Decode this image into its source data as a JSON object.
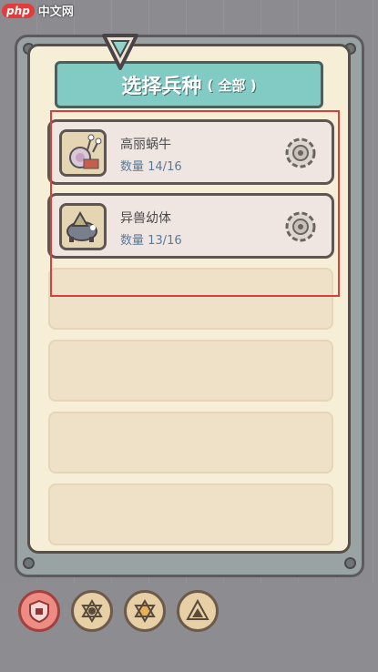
{
  "watermark": {
    "logo": "php",
    "text": "中文网"
  },
  "title": {
    "main": "选择兵种",
    "sub": "( 全部 )"
  },
  "units": [
    {
      "name": "高丽蜗牛",
      "count_label": "数量",
      "count": "14/16"
    },
    {
      "name": "异兽幼体",
      "count_label": "数量",
      "count": "13/16"
    }
  ],
  "empty_slots": 4,
  "bottom_buttons": [
    {
      "id": "defense",
      "icon": "shield-icon",
      "active": true
    },
    {
      "id": "hexagram-circle",
      "icon": "hexagram-icon",
      "active": false
    },
    {
      "id": "hexagram-star",
      "icon": "star-icon",
      "active": false
    },
    {
      "id": "triangle-filter",
      "icon": "triangle-icon",
      "active": false
    }
  ],
  "colors": {
    "accent": "#82cbc4",
    "highlight": "#d8403b",
    "count_text": "#5a7a9a"
  }
}
